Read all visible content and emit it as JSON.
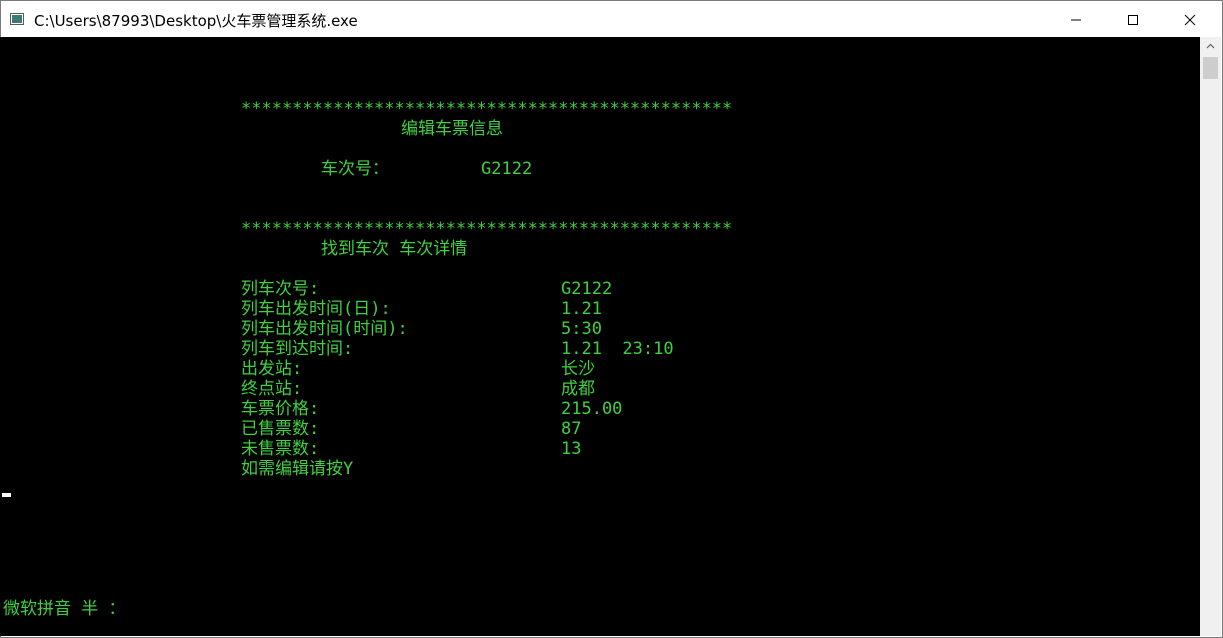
{
  "window": {
    "title": "C:\\Users\\87993\\Desktop\\火车票管理系统.exe"
  },
  "console": {
    "separator1": "************************************************",
    "header1": "编辑车票信息",
    "train_label": "车次号：",
    "train_value": "G2122",
    "separator2": "************************************************",
    "header2": "找到车次 车次详情",
    "details": [
      {
        "label": "列车次号:",
        "value": "G2122"
      },
      {
        "label": "列车出发时间(日):",
        "value": "1.21"
      },
      {
        "label": "列车出发时间(时间):",
        "value": "5:30"
      },
      {
        "label": "列车到达时间:",
        "value": "1.21  23:10"
      },
      {
        "label": "出发站:",
        "value": "长沙"
      },
      {
        "label": "终点站:",
        "value": "成都"
      },
      {
        "label": "车票价格:",
        "value": "215.00"
      },
      {
        "label": "已售票数:",
        "value": "87"
      },
      {
        "label": "未售票数:",
        "value": "13"
      }
    ],
    "prompt": "如需编辑请按Y",
    "ime_status": "微软拼音 半 ："
  },
  "colors": {
    "console_bg": "#000000",
    "console_text": "#3fd13f",
    "titlebar_bg": "#ffffff"
  }
}
